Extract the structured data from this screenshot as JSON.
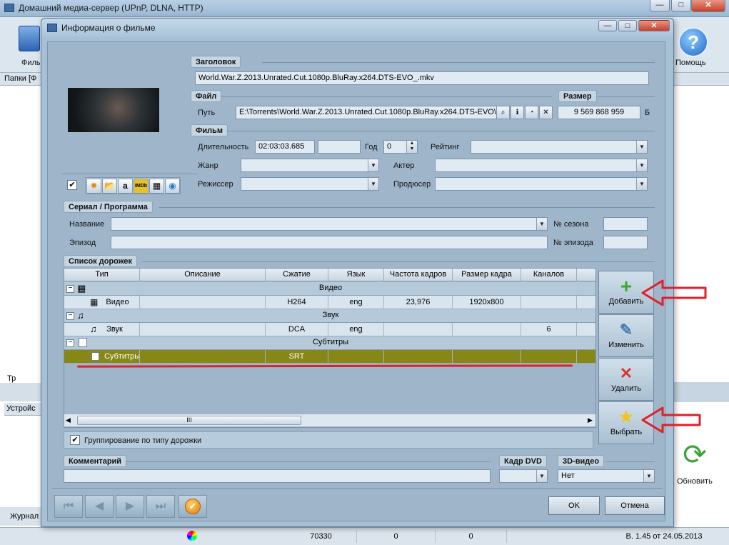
{
  "main_window": {
    "title": "Домашний медиа-сервер (UPnP, DLNA, HTTP)",
    "toolbar": {
      "left_label": "Филь",
      "help_label": "Помощь",
      "refresh_label": "Обновить"
    },
    "left_panel_header": "Папки [Ф",
    "left_tree_item": "Тр",
    "devices_label": "Устройс",
    "journal_label": "Журнал",
    "status": {
      "count": "70330",
      "v1": "0",
      "v2": "0",
      "version": "В. 1.45 от 24.05.2013"
    },
    "window_controls": {
      "minimize": "—",
      "restore": "□",
      "close": "✕"
    }
  },
  "dialog": {
    "title": "Информация о фильме",
    "window_controls": {
      "minimize": "—",
      "restore": "□",
      "close": "✕"
    },
    "sections": {
      "title": "Заголовок",
      "file": "Файл",
      "size": "Размер",
      "film": "Фильм",
      "series": "Сериал / Программа",
      "tracks": "Список дорожек",
      "comment": "Комментарий",
      "dvd_frame": "Кадр DVD",
      "video3d": "3D-видео"
    },
    "title_value": "World.War.Z.2013.Unrated.Cut.1080p.BluRay.x264.DTS-EVO_.mkv",
    "file": {
      "path_label": "Путь",
      "path_value": "E:\\Torrents\\World.War.Z.2013.Unrated.Cut.1080p.BluRay.x264.DTS-EVO\\",
      "size_value": "9 569 868 959",
      "size_unit": "Б"
    },
    "film": {
      "duration_label": "Длительность",
      "duration_value": "02:03:03.685",
      "year_label": "Год",
      "year_value": "0",
      "rating_label": "Рейтинг",
      "genre_label": "Жанр",
      "actor_label": "Актер",
      "director_label": "Режиссер",
      "producer_label": "Продюсер"
    },
    "series": {
      "name_label": "Название",
      "season_label": "№ сезона",
      "episode_label": "Эпизод",
      "episode_num_label": "№ эпизода"
    },
    "tracks_table": {
      "columns": [
        "Тип",
        "Описание",
        "Сжатие",
        "Язык",
        "Частота кадров",
        "Размер кадра",
        "Каналов"
      ],
      "groups": [
        {
          "label": "Видео",
          "rows": [
            {
              "type": "Видео",
              "desc": "",
              "codec": "H264",
              "lang": "eng",
              "fps": "23,976",
              "size": "1920x800",
              "channels": ""
            }
          ]
        },
        {
          "label": "Звук",
          "rows": [
            {
              "type": "Звук",
              "desc": "",
              "codec": "DCA",
              "lang": "eng",
              "fps": "",
              "size": "",
              "channels": "6"
            }
          ]
        },
        {
          "label": "Субтитры",
          "rows": [
            {
              "type": "Субтитры",
              "desc": "",
              "codec": "SRT",
              "lang": "",
              "fps": "",
              "size": "",
              "channels": ""
            }
          ]
        }
      ],
      "scroll_grip": "III",
      "group_by_label": "Группирование по типу дорожки"
    },
    "side_buttons": {
      "add": "Добавить",
      "edit": "Изменить",
      "delete": "Удалить",
      "select": "Выбрать"
    },
    "video3d_value": "Нет",
    "ok_label": "OK",
    "cancel_label": "Отмена"
  },
  "icons": {
    "sun": "✹",
    "folder": "📂",
    "globe": "◉",
    "play": "▶",
    "help": "?",
    "plus": "+",
    "cross": "✕",
    "star": "★",
    "check": "✔",
    "pencil": "✎",
    "chevron": "▼",
    "up": "▲",
    "down": "▼",
    "amazon": "a",
    "imdb": "IMDb",
    "film": "▦"
  },
  "colors": {
    "selected_row": "#878718",
    "annotation_red": "#e0202a",
    "add_green": "#3caa2a",
    "delete_red": "#d9362a",
    "star_yellow": "#f3c21b"
  }
}
